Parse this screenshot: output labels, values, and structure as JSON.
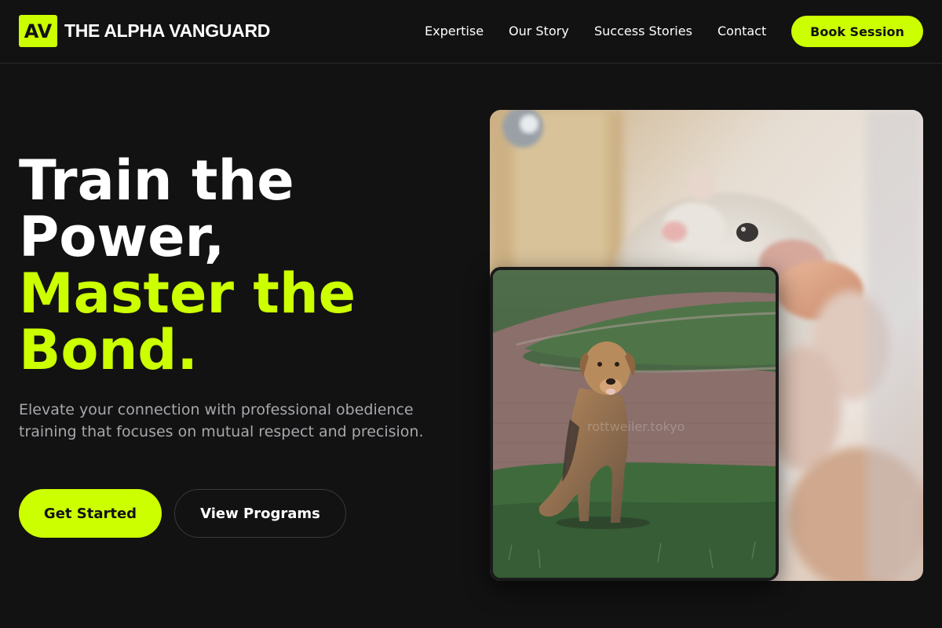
{
  "brand": {
    "mark": "AV",
    "name": "THE ALPHA VANGUARD",
    "accent_color": "#ccff00",
    "background_color": "#121212"
  },
  "nav": {
    "items": [
      {
        "label": "Expertise"
      },
      {
        "label": "Our Story"
      },
      {
        "label": "Success Stories"
      },
      {
        "label": "Contact"
      }
    ],
    "cta_label": "Book Session"
  },
  "hero": {
    "title_lines": [
      "Train the",
      "Power,"
    ],
    "accent_lines": [
      "Master the",
      "Bond."
    ],
    "subtitle": "Elevate your connection with professional obedience training that focuses on mutual respect and precision.",
    "primary_button": "Get Started",
    "secondary_button": "View Programs"
  },
  "images": {
    "large_photo": "hamster-photo",
    "small_photo": "dog-photo",
    "watermark": "rottweiler.tokyo"
  }
}
